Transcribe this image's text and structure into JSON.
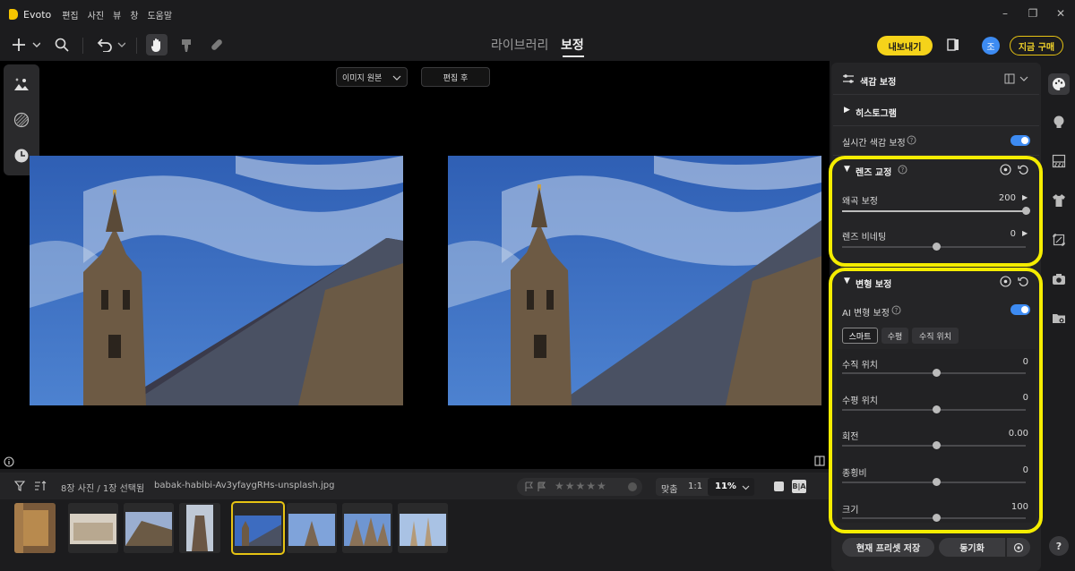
{
  "menubar": {
    "app_name": "Evoto",
    "items": [
      "편집",
      "사진",
      "뷰",
      "창",
      "도움말"
    ]
  },
  "toolbar": {
    "tabs": {
      "library": "라이브러리",
      "edit": "보정"
    },
    "export_label": "내보내기",
    "avatar_initial": "조",
    "buy_label": "지금 구매"
  },
  "canvas": {
    "view_select": "이미지 원본",
    "view_after": "편집 후"
  },
  "filmstrip": {
    "count_label": "8장 사진 / 1장 선택됨",
    "filename": "babak-habibi-Av3yfaygRHs-unsplash.jpg",
    "zoom_fit": "맞춤",
    "zoom_1to1": "1:1",
    "zoom_percent": "11%",
    "rating_stars": 0,
    "thumb_count": 8,
    "selected_thumb_index": 4
  },
  "panel": {
    "color_section": "색감 보정",
    "histogram": "히스토그램",
    "realtime_label": "실시간 색감 보정",
    "realtime_on": true,
    "lens": {
      "title": "렌즈 교정",
      "distortion_label": "왜곡 보정",
      "distortion_value": "200",
      "vignette_label": "렌즈 비네팅",
      "vignette_value": "0"
    },
    "transform": {
      "title": "변형 보정",
      "ai_label": "AI 변형 보정",
      "ai_on": true,
      "segments": [
        "스마트",
        "수평",
        "수직 위치"
      ],
      "sliders": [
        {
          "label": "수직 위치",
          "value": "0"
        },
        {
          "label": "수평 위치",
          "value": "0"
        },
        {
          "label": "회전",
          "value": "0.00"
        },
        {
          "label": "종횡비",
          "value": "0"
        },
        {
          "label": "크기",
          "value": "100"
        }
      ]
    },
    "save_preset": "현재 프리셋 저장",
    "sync": "동기화"
  },
  "colors": {
    "accent_yellow": "#f5d31a",
    "highlight_yellow": "#f5ed00",
    "toggle_blue": "#3d8bf2"
  }
}
